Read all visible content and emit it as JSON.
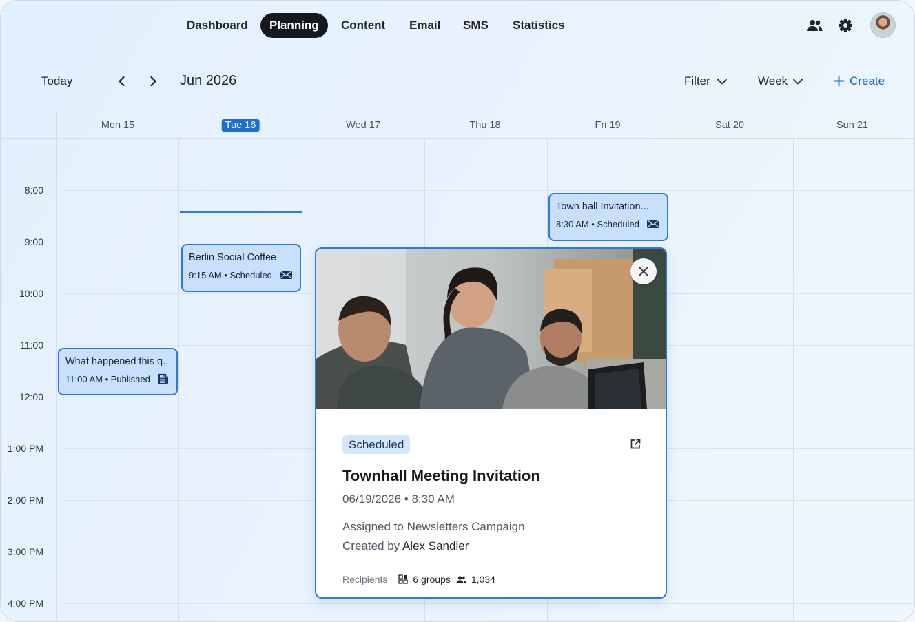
{
  "nav": {
    "tabs": [
      {
        "label": "Dashboard"
      },
      {
        "label": "Planning",
        "active": true
      },
      {
        "label": "Content"
      },
      {
        "label": "Email"
      },
      {
        "label": "SMS"
      },
      {
        "label": "Statistics"
      }
    ],
    "icons": [
      "users-icon",
      "gear-icon",
      "avatar"
    ]
  },
  "toolbar": {
    "today": "Today",
    "month": "Jun 2026",
    "filter": "Filter",
    "view": "Week",
    "create": "Create"
  },
  "days": [
    {
      "label": "Mon 15"
    },
    {
      "label": "Tue 16",
      "today": true
    },
    {
      "label": "Wed 17"
    },
    {
      "label": "Thu 18"
    },
    {
      "label": "Fri 19"
    },
    {
      "label": "Sat 20"
    },
    {
      "label": "Sun 21"
    }
  ],
  "times": [
    "8:00",
    "9:00",
    "10:00",
    "11:00",
    "12:00",
    "1:00 PM",
    "2:00 PM",
    "3:00 PM",
    "4:00 PM"
  ],
  "events": [
    {
      "title": "Town hall Invitation...",
      "meta": "8:30 AM • Scheduled",
      "icon": "envelope-icon"
    },
    {
      "title": "Berlin Social Coffee",
      "meta": "9:15 AM • Scheduled",
      "icon": "envelope-icon"
    },
    {
      "title": "What happened this q...",
      "meta": "11:00 AM • Published",
      "icon": "newspaper-icon"
    }
  ],
  "popover": {
    "status": "Scheduled",
    "title": "Townhall Meeting Invitation",
    "datetime": "06/19/2026 • 8:30 AM",
    "assigned_prefix": "Assigned to",
    "assigned_value": "Newsletters Campaign",
    "created_prefix": "Created by",
    "created_value": "Alex Sandler",
    "recipients_label": "Recipients",
    "groups": "6 groups",
    "count": "1,034"
  },
  "colors": {
    "accent": "#1a6fd6",
    "event_bg": "#c8e0fb",
    "event_border": "#2c79d9",
    "active_tab": "#15191f",
    "status_pill": "#d4e6fb"
  }
}
